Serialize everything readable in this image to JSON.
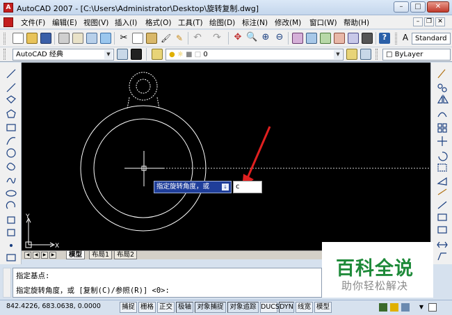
{
  "window": {
    "title": "AutoCAD 2007 - [C:\\Users\\Administrator\\Desktop\\旋转复制.dwg]",
    "app_icon_letter": "A"
  },
  "menubar": {
    "items": [
      "文件(F)",
      "编辑(E)",
      "视图(V)",
      "插入(I)",
      "格式(O)",
      "工具(T)",
      "绘图(D)",
      "标注(N)",
      "修改(M)",
      "窗口(W)",
      "帮助(H)"
    ]
  },
  "toolbar": {
    "text_style": "Standard",
    "workspace": "AutoCAD 经典",
    "layer": "0",
    "linetype": "ByLayer"
  },
  "canvas": {
    "tooltip_prompt": "指定旋转角度，或",
    "tooltip_key": "↓",
    "input_value": "c",
    "ucs_x": "X",
    "ucs_y": "Y"
  },
  "tabs": [
    "模型",
    "布局1",
    "布局2"
  ],
  "command": {
    "line1": "指定基点:",
    "line2": "指定旋转角度，或 [复制(C)/参照(R)] <0>:"
  },
  "status": {
    "coords": "842.4226, 683.0638, 0.0000",
    "buttons": [
      "捕捉",
      "栅格",
      "正交",
      "极轴",
      "对象捕捉",
      "对象追踪",
      "DUCS",
      "DYN",
      "线宽",
      "模型"
    ]
  },
  "watermark": {
    "title": "百科全说",
    "subtitle": "助你轻松解决"
  },
  "colors": {
    "canvas_bg": "#000000",
    "geometry": "#ffffff",
    "tooltip_bg": "#1f3e9a",
    "arrow": "#e02020",
    "watermark_green": "#1e8a39"
  }
}
